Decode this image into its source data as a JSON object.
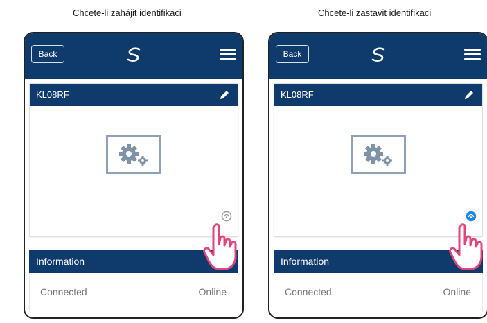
{
  "panels": [
    {
      "caption": "Chcete-li zahájit identifikaci",
      "back_label": "Back",
      "device_name": "KL08RF",
      "info_title": "Information",
      "status_label": "Connected",
      "status_value": "Online",
      "identify_state": "idle",
      "identify_color": "#9a9a9a"
    },
    {
      "caption": "Chcete-li zastavit identifikaci",
      "back_label": "Back",
      "device_name": "KL08RF",
      "info_title": "Information",
      "status_label": "Connected",
      "status_value": "Online",
      "identify_state": "active",
      "identify_color": "#1e88e5"
    }
  ],
  "colors": {
    "header_bg": "#0f3a6c",
    "hand_outline": "#e0457b",
    "image_frame": "#8ea2b4"
  },
  "icons": {
    "menu": "hamburger-menu-icon",
    "edit": "pencil-icon",
    "logo": "s-logo-icon",
    "device": "gear-image-icon",
    "identify": "identify-icon",
    "pointer": "hand-pointer-icon"
  }
}
